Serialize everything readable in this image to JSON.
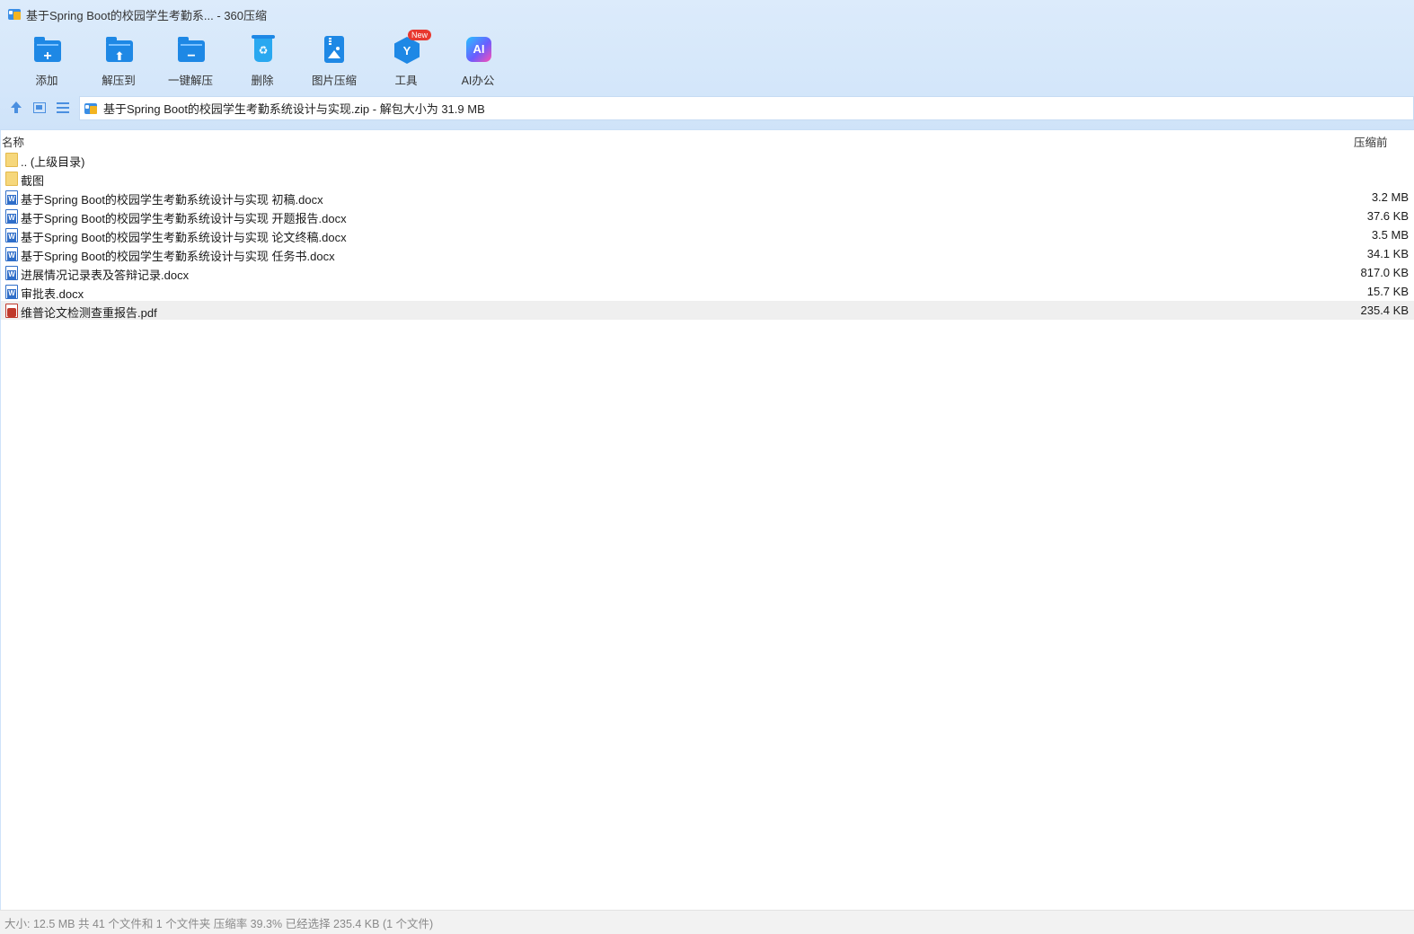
{
  "window": {
    "title": "基于Spring Boot的校园学生考勤系... - 360压缩"
  },
  "toolbar": {
    "items": [
      {
        "label": "添加",
        "icon": "add-folder-icon"
      },
      {
        "label": "解压到",
        "icon": "extract-to-icon"
      },
      {
        "label": "一键解压",
        "icon": "one-click-extract-icon"
      },
      {
        "label": "删除",
        "icon": "delete-bin-icon"
      },
      {
        "label": "图片压缩",
        "icon": "image-compress-icon"
      },
      {
        "label": "工具",
        "icon": "tools-icon",
        "badge": "New"
      },
      {
        "label": "AI办公",
        "icon": "ai-office-icon",
        "glyph": "AI"
      }
    ]
  },
  "address": {
    "path": "基于Spring Boot的校园学生考勤系统设计与实现.zip - 解包大小为 31.9 MB"
  },
  "list": {
    "columns": {
      "name": "名称",
      "size": "压缩前"
    },
    "rows": [
      {
        "name": ".. (上级目录)",
        "size": "",
        "type": "folder"
      },
      {
        "name": "截图",
        "size": "",
        "type": "folder"
      },
      {
        "name": "基于Spring Boot的校园学生考勤系统设计与实现 初稿.docx",
        "size": "3.2 MB",
        "type": "docx"
      },
      {
        "name": "基于Spring Boot的校园学生考勤系统设计与实现 开题报告.docx",
        "size": "37.6 KB",
        "type": "docx"
      },
      {
        "name": "基于Spring Boot的校园学生考勤系统设计与实现 论文终稿.docx",
        "size": "3.5 MB",
        "type": "docx"
      },
      {
        "name": "基于Spring Boot的校园学生考勤系统设计与实现 任务书.docx",
        "size": "34.1 KB",
        "type": "docx"
      },
      {
        "name": "进展情况记录表及答辩记录.docx",
        "size": "817.0 KB",
        "type": "docx"
      },
      {
        "name": "审批表.docx",
        "size": "15.7 KB",
        "type": "docx"
      },
      {
        "name": "维普论文检测查重报告.pdf",
        "size": "235.4 KB",
        "type": "pdf",
        "selected": true
      }
    ]
  },
  "status": {
    "text": "大小: 12.5 MB 共 41 个文件和 1 个文件夹 压缩率 39.3% 已经选择 235.4 KB (1 个文件)"
  },
  "colors": {
    "chrome": "#d5e7fa",
    "accent": "#1e88e5",
    "badge": "#e8382f",
    "selected_row": "#efefef"
  }
}
